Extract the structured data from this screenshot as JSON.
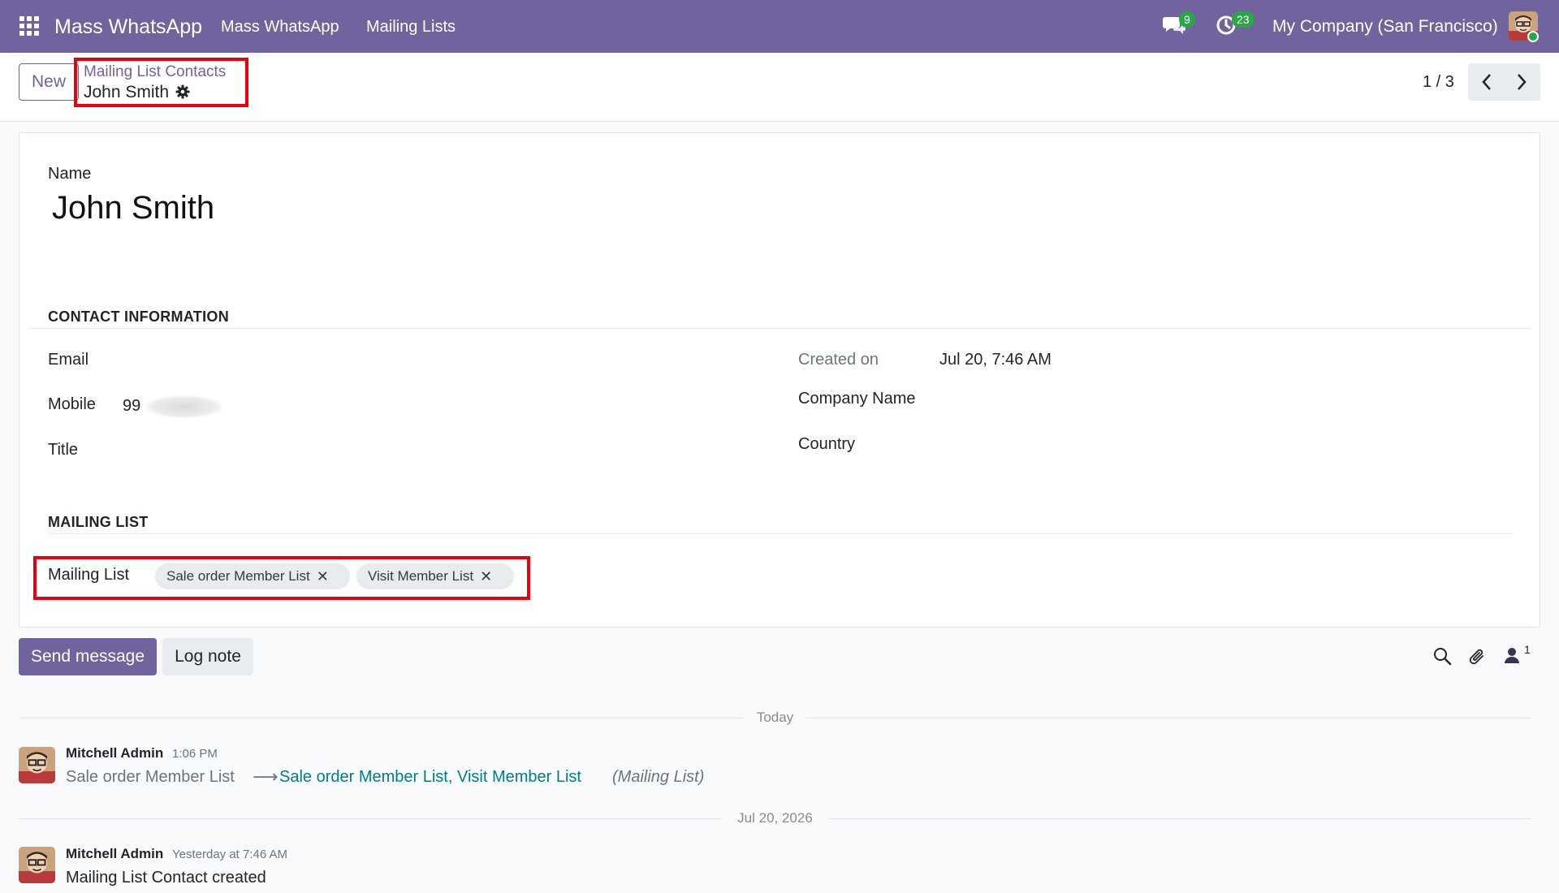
{
  "topbar": {
    "brand": "Mass WhatsApp",
    "menu": [
      "Mass WhatsApp",
      "Mailing Lists"
    ],
    "chat_badge": "9",
    "activity_badge": "23",
    "company": "My Company (San Francisco)"
  },
  "control": {
    "new_label": "New",
    "breadcrumb_parent": "Mailing List Contacts",
    "breadcrumb_current": "John Smith",
    "pager": "1 / 3"
  },
  "form": {
    "name_label": "Name",
    "name_value": "John Smith",
    "contact_section": "CONTACT INFORMATION",
    "email_label": "Email",
    "mobile_label": "Mobile",
    "mobile_value": "99",
    "title_label": "Title",
    "created_label": "Created on",
    "created_value": "Jul 20, 7:46 AM",
    "company_label": "Company Name",
    "country_label": "Country",
    "mailing_section": "MAILING LIST",
    "mailing_label": "Mailing List",
    "tags": [
      "Sale order Member List",
      "Visit Member List"
    ]
  },
  "chatter": {
    "send_label": "Send message",
    "log_label": "Log note",
    "follower_count": "1",
    "separators": [
      "Today",
      "Jul 20, 2026"
    ],
    "messages": [
      {
        "author": "Mitchell Admin",
        "time": "1:06 PM",
        "old_value": "Sale order Member List",
        "arrow": "⟶",
        "new_value": "Sale order Member List, Visit Member List",
        "field": "(Mailing List)"
      },
      {
        "author": "Mitchell Admin",
        "time": "Yesterday at 7:46 AM",
        "body": "Mailing List Contact created"
      }
    ]
  },
  "colors": {
    "brand_purple": "#71639e",
    "highlight_red": "#e8000b",
    "badge_green": "#28a745",
    "tracking_teal": "#017e84"
  }
}
